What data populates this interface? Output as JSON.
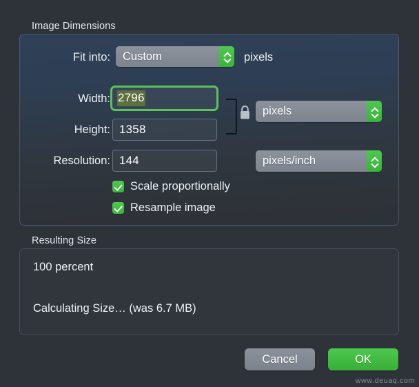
{
  "dialog": {
    "accent_green": "#3cb53c",
    "focus_ring_green": "#5cc25c",
    "selection_green": "#5d7040",
    "background": "#2e3339",
    "panel_blue": "#2f4158"
  },
  "image_dimensions": {
    "title": "Image Dimensions",
    "fit_into": {
      "label": "Fit into:",
      "value": "Custom",
      "unit_suffix": "pixels"
    },
    "width": {
      "label": "Width:",
      "value": "2796",
      "selected": true,
      "unit": "pixels"
    },
    "height": {
      "label": "Height:",
      "value": "1358"
    },
    "resolution": {
      "label": "Resolution:",
      "value": "144",
      "unit": "pixels/inch"
    },
    "link_lock_icon": "lock-closed-icon",
    "checkboxes": [
      {
        "label": "Scale proportionally",
        "checked": true
      },
      {
        "label": "Resample image",
        "checked": true
      }
    ]
  },
  "resulting_size": {
    "title": "Resulting Size",
    "percent_line": "100 percent",
    "size_line": "Calculating Size… (was 6.7 MB)"
  },
  "footer": {
    "cancel_label": "Cancel",
    "ok_label": "OK"
  },
  "watermark": {
    "text": "www.deuaq.com"
  }
}
